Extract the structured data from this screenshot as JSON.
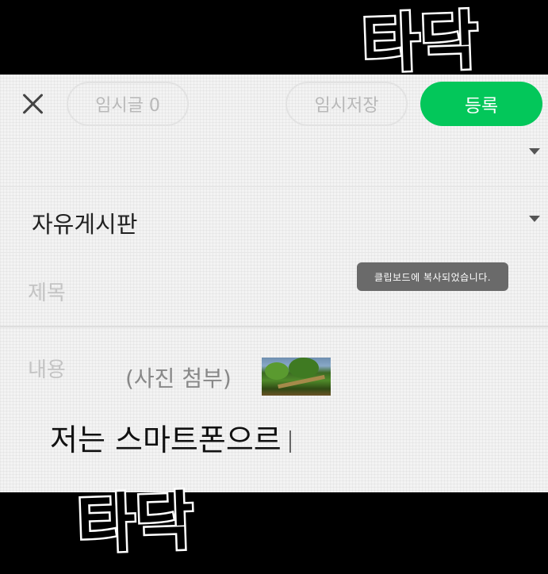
{
  "header": {
    "drafts_label": "임시글 0",
    "temp_save_label": "임시저장",
    "submit_label": "등록"
  },
  "form": {
    "board_value": "자유게시판",
    "title_placeholder": "제목",
    "content_label": "내용",
    "photo_attachment_note": "(사진 첨부)",
    "typed_text": "저는 스마트폰으르"
  },
  "toast": {
    "message": "클립보드에 복사되었습니다."
  },
  "overlay": {
    "sfx_top": "타닥",
    "sfx_bottom": "타닥"
  },
  "colors": {
    "accent": "#03c75a",
    "toast_bg": "#6a6a6a"
  },
  "icons": {
    "close": "close-icon",
    "dropdown": "chevron-down-icon"
  }
}
